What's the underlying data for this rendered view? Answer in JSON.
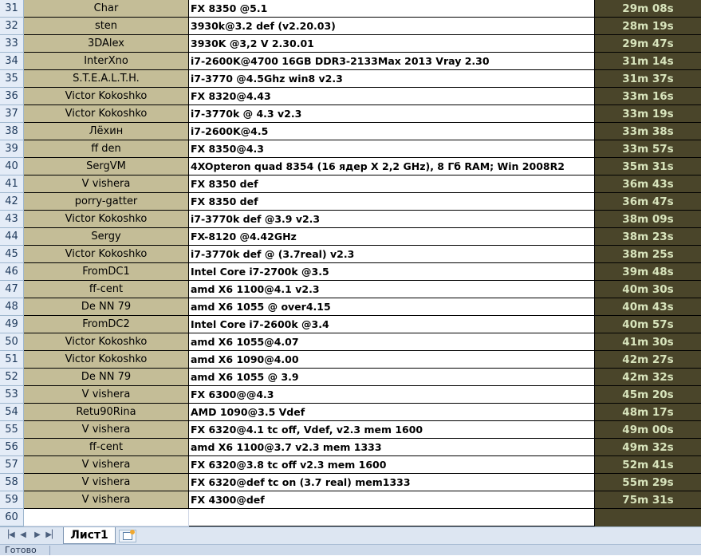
{
  "rows": [
    {
      "num": "31",
      "name": "Char",
      "cpu": "FX 8350 @5.1",
      "time": "29m 08s"
    },
    {
      "num": "32",
      "name": "sten",
      "cpu": "3930k@3.2 def (v2.20.03)",
      "time": "28m 19s"
    },
    {
      "num": "33",
      "name": "3DAlex",
      "cpu": "3930K @3,2 V 2.30.01",
      "time": "29m 47s"
    },
    {
      "num": "34",
      "name": "InterXno",
      "cpu": "i7-2600K@4700 16GB DDR3-2133Max 2013 Vray 2.30",
      "time": "31m 14s"
    },
    {
      "num": "35",
      "name": "S.T.E.A.L.T.H.",
      "cpu": "i7-3770 @4.5Ghz win8  v2.3",
      "time": "31m 37s"
    },
    {
      "num": "36",
      "name": "Victor Kokoshko",
      "cpu": "FX 8320@4.43",
      "time": "33m 16s"
    },
    {
      "num": "37",
      "name": "Victor Kokoshko",
      "cpu": "i7-3770k  @ 4.3  v2.3",
      "time": "33m 19s"
    },
    {
      "num": "38",
      "name": "Лёхин",
      "cpu": "i7-2600K@4.5",
      "time": "33m 38s"
    },
    {
      "num": "39",
      "name": "ff den",
      "cpu": "FX 8350@4.3",
      "time": "33m 57s"
    },
    {
      "num": "40",
      "name": "SergVM",
      "cpu": "4XOpteron quad 8354 (16 ядер X 2,2 GHz), 8 Гб RAM; Win 2008R2",
      "time": "35m 31s"
    },
    {
      "num": "41",
      "name": "V vishera",
      "cpu": "FX 8350 def",
      "time": "36m 43s"
    },
    {
      "num": "42",
      "name": "porry-gatter",
      "cpu": "FX 8350 def",
      "time": "36m 47s"
    },
    {
      "num": "43",
      "name": "Victor Kokoshko",
      "cpu": "i7-3770k def @3.9 v2.3",
      "time": "38m 09s"
    },
    {
      "num": "44",
      "name": "Sergy",
      "cpu": "FX-8120 @4.42GHz",
      "time": "38m 23s"
    },
    {
      "num": "45",
      "name": "Victor Kokoshko",
      "cpu": "i7-3770k def @ (3.7real) v2.3",
      "time": "38m 25s"
    },
    {
      "num": "46",
      "name": "FromDC1",
      "cpu": "Intel Core i7-2700k @3.5",
      "time": "39m 48s"
    },
    {
      "num": "47",
      "name": "ff-cent",
      "cpu": "amd X6 1100@4.1 v2.3",
      "time": "40m 30s"
    },
    {
      "num": "48",
      "name": "De NN 79",
      "cpu": "amd X6 1055 @ over4.15",
      "time": "40m 43s"
    },
    {
      "num": "49",
      "name": "FromDC2",
      "cpu": "Intel Core i7-2600k @3.4",
      "time": "40m 57s"
    },
    {
      "num": "50",
      "name": "Victor Kokoshko",
      "cpu": "amd X6 1055@4.07",
      "time": "41m 30s"
    },
    {
      "num": "51",
      "name": "Victor Kokoshko",
      "cpu": "amd X6 1090@4.00",
      "time": "42m 27s"
    },
    {
      "num": "52",
      "name": "De NN 79",
      "cpu": "amd X6 1055 @ 3.9",
      "time": "42m 32s"
    },
    {
      "num": "53",
      "name": "V vishera",
      "cpu": "FX 6300@@4.3",
      "time": "45m 20s"
    },
    {
      "num": "54",
      "name": "Retu90Rina",
      "cpu": "AMD 1090@3.5 Vdef",
      "time": "48m 17s"
    },
    {
      "num": "55",
      "name": "V vishera",
      "cpu": "FX 6320@4.1 tc off,   Vdef, v2.3 mem 1600",
      "time": "49m 00s"
    },
    {
      "num": "56",
      "name": "ff-cent",
      "cpu": "amd X6 1100@3.7 v2.3  mem 1333",
      "time": "49m 32s"
    },
    {
      "num": "57",
      "name": "V vishera",
      "cpu": "FX 6320@3.8 tc off v2.3 mem 1600",
      "time": "52m 41s"
    },
    {
      "num": "58",
      "name": "V vishera",
      "cpu": "FX 6320@def tc on (3.7 real) mem1333",
      "time": "55m 29s"
    },
    {
      "num": "59",
      "name": "V vishera",
      "cpu": "FX 4300@def",
      "time": "75m 31s"
    }
  ],
  "empty_row": {
    "num": "60"
  },
  "tabs": {
    "sheet_label": "Лист1"
  },
  "status": {
    "text": "Готово"
  },
  "colors": {
    "name_bg": "#c4bd97",
    "time_bg": "#4a452a",
    "time_fg": "#d8e4bc",
    "header_bg": "#e4ecf7"
  }
}
